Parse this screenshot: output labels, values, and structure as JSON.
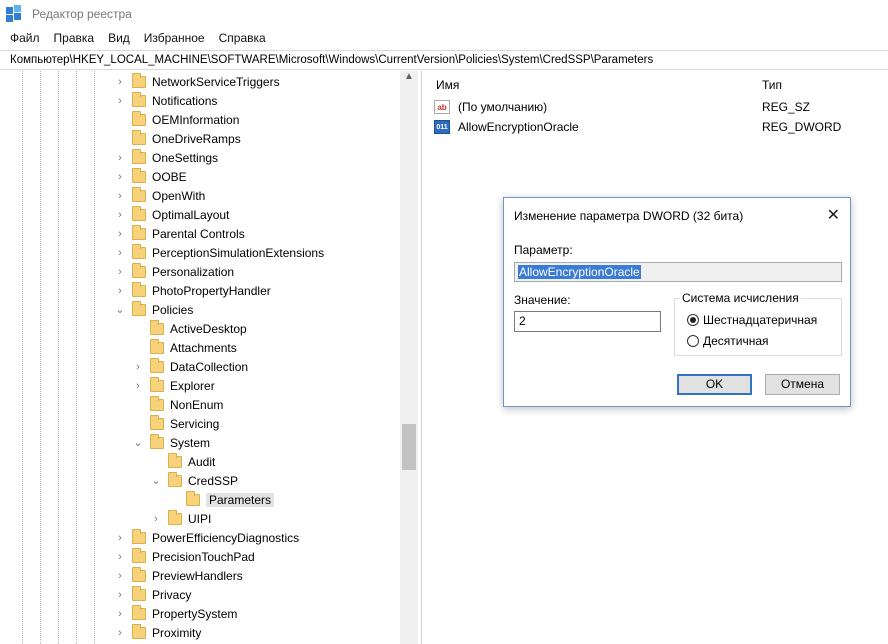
{
  "window": {
    "title": "Редактор реестра"
  },
  "menu": [
    "Файл",
    "Правка",
    "Вид",
    "Избранное",
    "Справка"
  ],
  "address": "Компьютер\\HKEY_LOCAL_MACHINE\\SOFTWARE\\Microsoft\\Windows\\CurrentVersion\\Policies\\System\\CredSSP\\Parameters",
  "tree": {
    "top_items": [
      "NetworkServiceTriggers",
      "Notifications",
      "OEMInformation",
      "OneDriveRamps",
      "OneSettings",
      "OOBE",
      "OpenWith",
      "OptimalLayout",
      "Parental Controls",
      "PerceptionSimulationExtensions",
      "Personalization",
      "PhotoPropertyHandler",
      "Policies"
    ],
    "policies_children": [
      "ActiveDesktop",
      "Attachments",
      "DataCollection",
      "Explorer",
      "NonEnum",
      "Servicing",
      "System"
    ],
    "system_children": [
      "Audit",
      "CredSSP"
    ],
    "credssp_children": [
      "Parameters"
    ],
    "uipi": "UIPI",
    "bottom_items": [
      "PowerEfficiencyDiagnostics",
      "PrecisionTouchPad",
      "PreviewHandlers",
      "Privacy",
      "PropertySystem",
      "Proximity"
    ]
  },
  "list": {
    "col_name": "Имя",
    "col_type": "Тип",
    "rows": [
      {
        "name": "(По умолчанию)",
        "type": "REG_SZ",
        "icon": "string-value-icon",
        "icon_text": "ab"
      },
      {
        "name": "AllowEncryptionOracle",
        "type": "REG_DWORD",
        "icon": "dword-value-icon",
        "icon_text": "011"
      }
    ]
  },
  "dialog": {
    "title": "Изменение параметра DWORD (32 бита)",
    "close": "✕",
    "param_label": "Параметр:",
    "param_value": "AllowEncryptionOracle",
    "value_label": "Значение:",
    "value_data": "2",
    "radix_label": "Система исчисления",
    "radix_hex": "Шестнадцатеричная",
    "radix_dec": "Десятичная",
    "radix_selected": "hex",
    "ok": "OK",
    "cancel": "Отмена"
  }
}
